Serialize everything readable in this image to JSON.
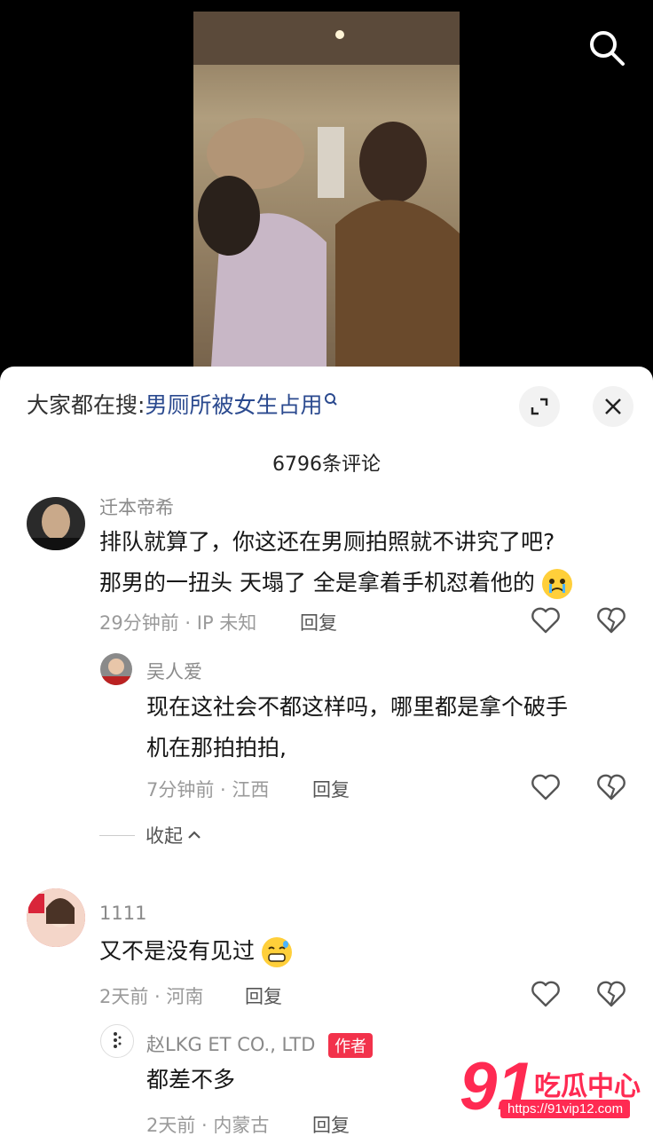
{
  "search_hint": {
    "prefix": "大家都在搜:",
    "keyword": "男厕所被女生占用"
  },
  "comment_count": "6796条评论",
  "comments": [
    {
      "user": "迁本帝希",
      "text_line1": "排队就算了，你这还在男厕拍照就不讲究了吧?",
      "text_line2": "那男的一扭头 天塌了 全是拿着手机怼着他的",
      "meta": "29分钟前 · IP 未知",
      "reply_label": "回复",
      "replies": [
        {
          "user": "吴人爱",
          "text_line1": "现在这社会不都这样吗，哪里都是拿个破手",
          "text_line2": "机在那拍拍拍,",
          "meta": "7分钟前 · 江西",
          "reply_label": "回复"
        }
      ],
      "collapse_label": "收起"
    },
    {
      "user": "1111",
      "text_line1": "又不是没有见过",
      "meta": "2天前 · 河南",
      "reply_label": "回复",
      "replies": [
        {
          "user": "赵LKG ET CO., LTD",
          "badge": "作者",
          "text_line1": "都差不多",
          "meta": "2天前 · 内蒙古",
          "reply_label": "回复"
        }
      ]
    }
  ],
  "watermark": {
    "number": "91",
    "text": "吃瓜中心",
    "url": "https://91vip12.com"
  },
  "colors": {
    "accent": "#ff2a52",
    "keyword": "#2b4a8f",
    "badge": "#f2324b"
  }
}
